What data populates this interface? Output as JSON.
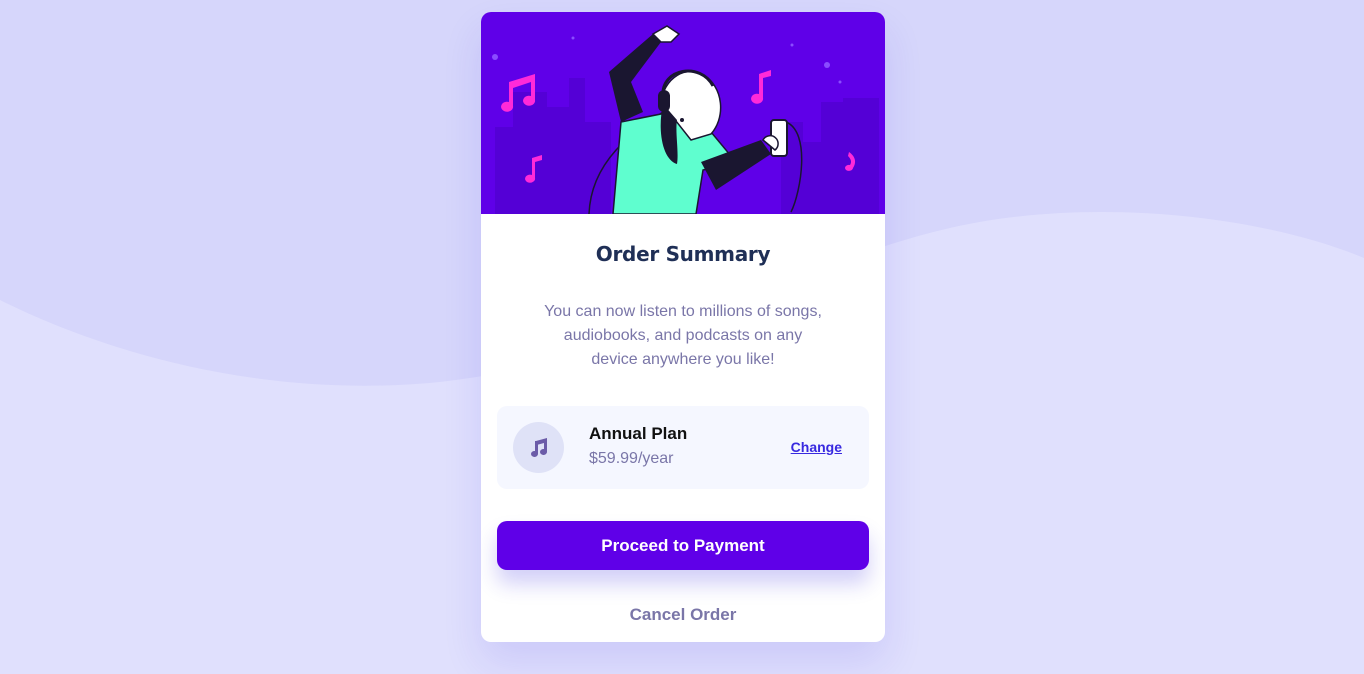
{
  "colors": {
    "page_background": "#e0e0fd",
    "wave": "#d6d6fb",
    "hero_background": "#5f00e8",
    "primary_button": "#5f00e8",
    "link": "#3829e0",
    "title_text": "#1f2f56",
    "muted_text": "#7a76a8",
    "plan_background": "#f5f7ff"
  },
  "hero": {
    "icon": "person-dancing-with-headphones-illustration"
  },
  "summary": {
    "title": "Order Summary",
    "description": "You can now listen to millions of songs, audiobooks, and podcasts on any device anywhere you like!"
  },
  "plan": {
    "icon": "music-note-icon",
    "name": "Annual Plan",
    "price": "$59.99/year",
    "change_label": "Change"
  },
  "actions": {
    "proceed_label": "Proceed to Payment",
    "cancel_label": "Cancel Order"
  }
}
